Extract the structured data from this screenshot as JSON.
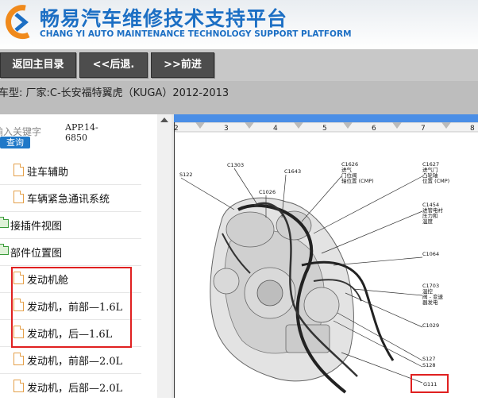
{
  "header": {
    "title": "畅易汽车维修技术支持平台",
    "subtitle": "CHANG YI AUTO MAINTENANCE TECHNOLOGY SUPPORT PLATFORM",
    "logo_text": "C"
  },
  "toolbar": {
    "home_label": "返回主目录",
    "back_label": "<<后退.",
    "forward_label": ">>前进"
  },
  "info": {
    "vehicle_text": "车型:   厂家:C-长安福特翼虎（KUGA）2012-2013"
  },
  "search": {
    "placeholder": "输入关键字",
    "button_label": "查询",
    "app_label": "APP.14-6850"
  },
  "tree": {
    "items": [
      {
        "label": "驻车辅助"
      },
      {
        "label": "车辆紧急通讯系统"
      },
      {
        "label": "接插件视图"
      },
      {
        "label": "部件位置图"
      },
      {
        "label": "发动机舱"
      },
      {
        "label": "发动机，前部—1.6L"
      },
      {
        "label": "发动机，后—1.6L"
      },
      {
        "label": "发动机，前部—2.0L"
      },
      {
        "label": "发动机，后部—2.0L"
      }
    ]
  },
  "diagram": {
    "column_numbers": [
      "2",
      "3",
      "4",
      "5",
      "6",
      "7",
      "8"
    ],
    "callouts": {
      "s122": "S122",
      "c1303": "C1303",
      "c1643": "C1643",
      "c1626": "C1626",
      "c1626_l1": "进气",
      "c1626_l2": "门位阀",
      "c1626_l3": "轴位置 (CMP)",
      "c1627": "C1627",
      "c1627_l1": "进气门",
      "c1627_l2": "凸轮轴",
      "c1627_l3": "位置 (CMP)",
      "c1026": "C1026",
      "c1454": "C1454",
      "c1454_l1": "进管电衬",
      "c1454_l2": "压力和",
      "c1454_l3": "温度",
      "c1064": "C1064",
      "c1703": "C1703",
      "c1703_l1": "温控",
      "c1703_l2": "阀 - 变速",
      "c1703_l3": "器发电",
      "c1029": "C1029",
      "s127": "S127",
      "s128": "S128",
      "g111": "G111"
    }
  },
  "colors": {
    "brand_blue": "#1c6fc4",
    "toolbar_button": "#4d4d4d",
    "highlight_red": "#e02020",
    "query_button": "#1f78c8"
  }
}
